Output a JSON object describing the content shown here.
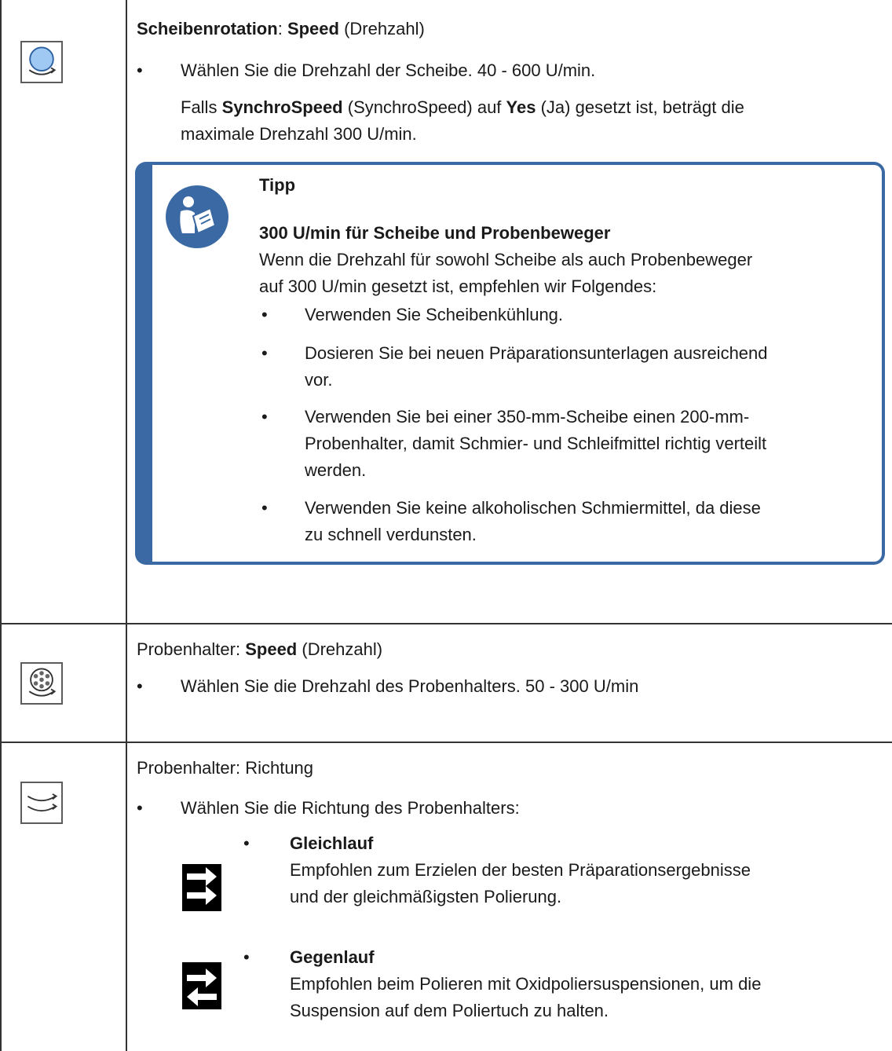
{
  "row1": {
    "title_bold": "Scheibenrotation",
    "title_colon": ":",
    "title_bold2": "Speed",
    "title_rest": "(Drehzahl)",
    "bullet1": "Wählen Sie die Drehzahl der Scheibe. 40 - 600 U/min.",
    "note_pre": "Falls",
    "note_bold1": "SynchroSpeed",
    "note_mid1": "(SynchroSpeed) auf",
    "note_bold2": "Yes",
    "note_mid2": "(Ja) gesetzt ist, beträgt die",
    "note_line2": "maximale Drehzahl 300 U/min.",
    "tip": {
      "label": "Tipp",
      "heading": "300 U/min für Scheibe und Probenbeweger",
      "intro_line1": "Wenn die Drehzahl für sowohl Scheibe als auch Probenbeweger",
      "intro_line2": "auf 300 U/min gesetzt ist, empfehlen wir Folgendes:",
      "items": [
        {
          "lines": [
            "Verwenden Sie Scheibenkühlung."
          ]
        },
        {
          "lines": [
            "Dosieren Sie bei neuen Präparationsunterlagen ausreichend",
            "vor."
          ]
        },
        {
          "lines": [
            "Verwenden Sie bei einer 350-mm-Scheibe einen 200-mm-",
            "Probenhalter, damit Schmier- und Schleifmittel richtig verteilt",
            "werden."
          ]
        },
        {
          "lines": [
            "Verwenden Sie keine alkoholischen Schmiermittel, da diese",
            "zu schnell verdunsten."
          ]
        }
      ]
    }
  },
  "row2": {
    "title_pre": "Probenhalter:",
    "title_bold": "Speed",
    "title_rest": "(Drehzahl)",
    "bullet1": "Wählen Sie die Drehzahl des Probenhalters. 50 - 300 U/min"
  },
  "row3": {
    "title": "Probenhalter: Richtung",
    "bullet1": "Wählen Sie die Richtung des Probenhalters:",
    "options": [
      {
        "title": "Gleichlauf",
        "line1": "Empfohlen zum Erzielen der besten Präparationsergebnisse",
        "line2": "und der gleichmäßigsten Polierung."
      },
      {
        "title": "Gegenlauf",
        "line1": "Empfohlen beim Polieren mit Oxidpoliersuspensionen, um die",
        "line2": "Suspension auf dem Poliertuch zu halten."
      }
    ]
  },
  "bullet_char": "•",
  "colors": {
    "tip_border": "#3a69a3",
    "disc_fill": "#9fc8f2",
    "table_line": "#333333"
  },
  "icons": {
    "row1": "disc-rotation-icon",
    "row2": "specimen-holder-rotation-icon",
    "row3": "holder-direction-icon",
    "tip": "read-manual-icon",
    "option1": "same-direction-arrows-icon",
    "option2": "opposite-direction-arrows-icon"
  }
}
